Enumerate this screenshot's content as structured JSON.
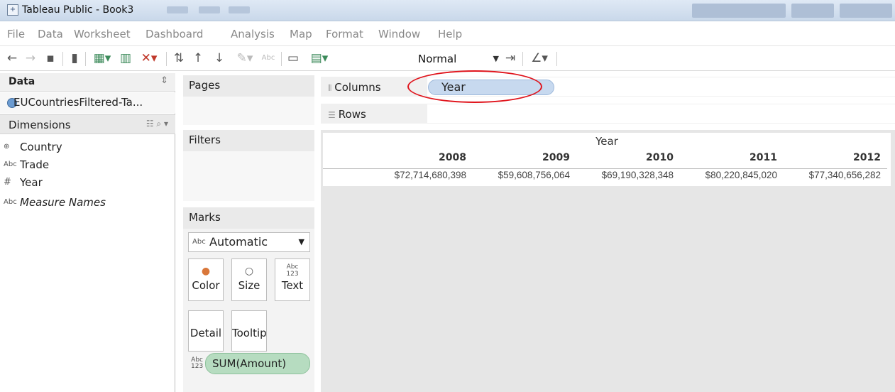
{
  "window": {
    "title": "Tableau Public - Book3",
    "app_icon": "tableau-app-icon"
  },
  "menu": [
    "File",
    "Data",
    "Worksheet",
    "Dashboard",
    "Analysis",
    "Map",
    "Format",
    "Window",
    "Help"
  ],
  "toolbar": {
    "icons": [
      "back-icon",
      "forward-icon",
      "save-icon",
      "datasource-icon",
      "new-worksheet-icon",
      "new-dashboard-icon",
      "clear-sheet-icon",
      "swap-icon",
      "sort-ascending-icon",
      "sort-descending-icon",
      "highlight-icon",
      "labels-icon",
      "presentation-icon",
      "show-me-icon",
      "fix-axes-icon",
      "annotate-icon"
    ],
    "abc_label": "Abc",
    "fit_value": "Normal"
  },
  "data_pane": {
    "header": "Data",
    "datasource": "EUCountriesFiltered-Ta...",
    "dimensions_header": "Dimensions",
    "fields": [
      {
        "type": "⊕",
        "name": "Country",
        "italic": false
      },
      {
        "type": "Abc",
        "name": "Trade",
        "italic": false
      },
      {
        "type": "#",
        "name": "Year",
        "italic": false
      },
      {
        "type": "Abc",
        "name": "Measure Names",
        "italic": true
      }
    ]
  },
  "cards": {
    "pages": "Pages",
    "filters": "Filters",
    "marks": "Marks",
    "mark_type": "Automatic",
    "mark_type_icon": "Abc",
    "buttons": {
      "color": "Color",
      "size": "Size",
      "text": "Text",
      "detail": "Detail",
      "tooltip": "Tooltip"
    },
    "text_icon": "Abc\n123",
    "measure_pill": "SUM(Amount)"
  },
  "shelves": {
    "columns_label": "Columns",
    "rows_label": "Rows",
    "columns_pill": "Year"
  },
  "table": {
    "title": "Year",
    "headers": [
      "2008",
      "2009",
      "2010",
      "2011",
      "2012"
    ],
    "values": [
      "$72,714,680,398",
      "$59,608,756,064",
      "$69,190,328,348",
      "$80,220,845,020",
      "$77,340,656,282"
    ]
  },
  "colors": {
    "columns_pill": "#c7d9ef",
    "measure_pill": "#b6dcc0",
    "highlight": "#e0141c"
  }
}
